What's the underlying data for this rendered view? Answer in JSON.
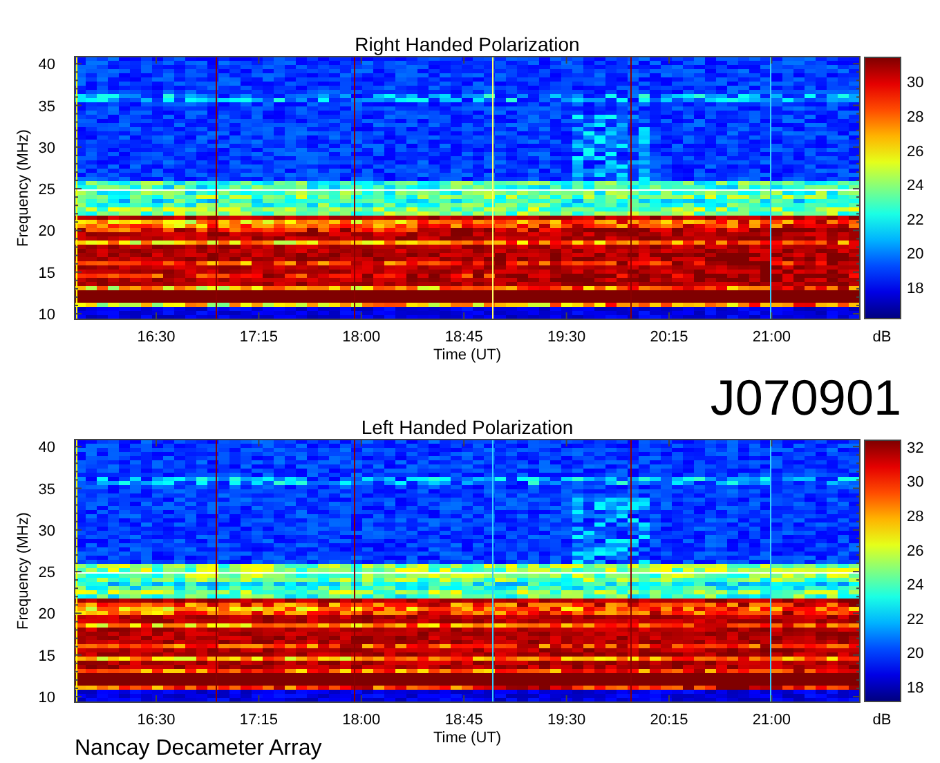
{
  "panels": [
    {
      "title": "Right Handed Polarization",
      "ylabel": "Frequency (MHz)",
      "yticks": [
        "40",
        "35",
        "30",
        "25",
        "20",
        "15",
        "10"
      ],
      "xticks": [
        "16:30",
        "17:15",
        "18:00",
        "18:45",
        "19:30",
        "20:15",
        "21:00"
      ],
      "xlabel": "Time (UT)",
      "colorbar_ticks": [
        "30",
        "28",
        "26",
        "24",
        "22",
        "20",
        "18"
      ],
      "colorbar_label": "dB"
    },
    {
      "title": "Left Handed Polarization",
      "ylabel": "Frequency (MHz)",
      "yticks": [
        "40",
        "35",
        "30",
        "25",
        "20",
        "15",
        "10"
      ],
      "xticks": [
        "16:30",
        "17:15",
        "18:00",
        "18:45",
        "19:30",
        "20:15",
        "21:00"
      ],
      "xlabel": "Time (UT)",
      "colorbar_ticks": [
        "32",
        "30",
        "28",
        "26",
        "24",
        "22",
        "20",
        "18"
      ],
      "colorbar_label": "dB"
    }
  ],
  "observation_id": "J070901",
  "instrument": "Nancay Decameter Array"
}
